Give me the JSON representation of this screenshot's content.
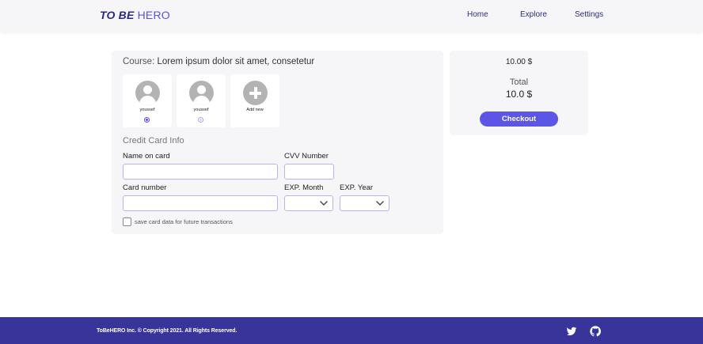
{
  "header": {
    "logo_part1": "TO BE",
    "logo_part2": "HERO",
    "nav": [
      "Home",
      "Explore",
      "Settings"
    ]
  },
  "course": {
    "label": "Course:",
    "title": "Lorem ipsum dolor sit amet, consetetur"
  },
  "accounts": [
    {
      "name": "youssef",
      "selected": true
    },
    {
      "name": "youssef",
      "selected": false
    }
  ],
  "add_account_label": "Add new",
  "credit_card": {
    "section_title": "Credit Card Info",
    "name_label": "Name on card",
    "name_value": "",
    "cvv_label": "CVV Number",
    "cvv_value": "",
    "number_label": "Card number",
    "number_value": "",
    "exp_month_label": "EXP. Month",
    "exp_month_value": "",
    "exp_year_label": "EXP. Year",
    "exp_year_value": "",
    "save_label": "save card data for future transactions",
    "save_checked": false
  },
  "summary": {
    "price": "10.00 $",
    "total_label": "Total",
    "total_value": "10.0 $",
    "checkout_label": "Checkout"
  },
  "footer": {
    "copyright": "ToBeHERO Inc. © Copyright 2021. All Rights Reserved.",
    "icons": [
      "twitter-icon",
      "github-icon"
    ]
  },
  "colors": {
    "accent": "#5d55e6",
    "brand_dark": "#2a2a86",
    "footer_bg": "#38349a"
  }
}
